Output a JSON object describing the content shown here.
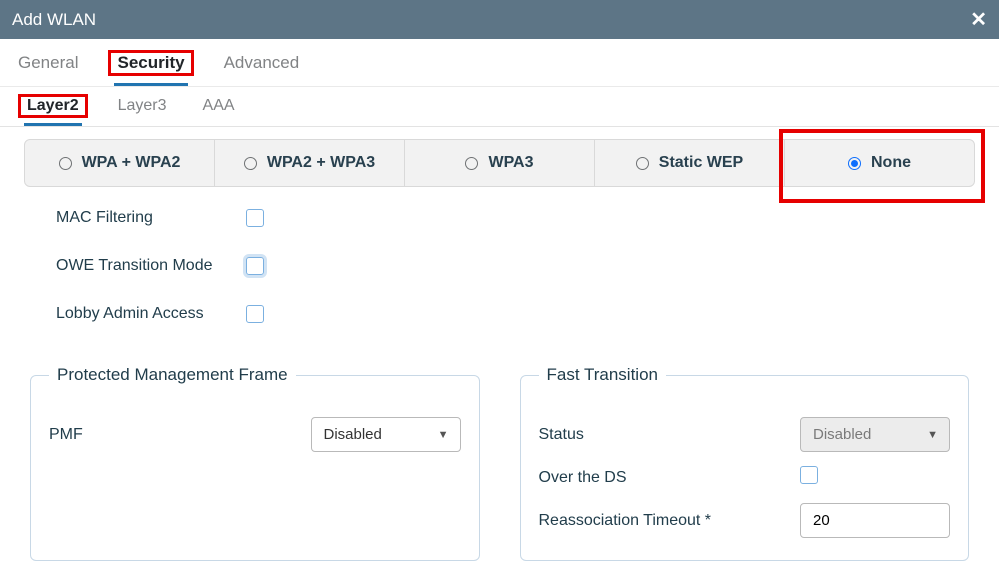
{
  "modal_title": "Add WLAN",
  "tabs": {
    "general": "General",
    "security": "Security",
    "advanced": "Advanced"
  },
  "subtabs": {
    "layer2": "Layer2",
    "layer3": "Layer3",
    "aaa": "AAA"
  },
  "security_modes": {
    "wpa_wpa2": "WPA + WPA2",
    "wpa2_wpa3": "WPA2 + WPA3",
    "wpa3": "WPA3",
    "static_wep": "Static WEP",
    "none": "None",
    "selected": "none"
  },
  "checks": {
    "mac_filtering": "MAC Filtering",
    "owe_transition": "OWE Transition Mode",
    "lobby_admin": "Lobby Admin Access"
  },
  "pmf": {
    "legend": "Protected Management Frame",
    "label": "PMF",
    "value": "Disabled"
  },
  "ft": {
    "legend": "Fast Transition",
    "status_label": "Status",
    "status_value": "Disabled",
    "over_ds_label": "Over the DS",
    "reassoc_label": "Reassociation Timeout *",
    "reassoc_value": "20"
  }
}
